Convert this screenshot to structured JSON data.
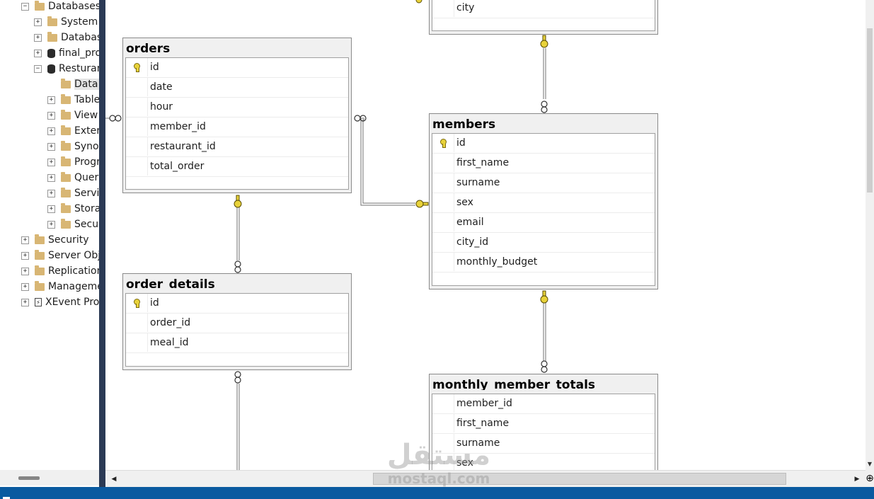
{
  "explorer": {
    "nodes": [
      {
        "label": "Databases",
        "level": 0,
        "expander": "minus",
        "icon": "folder-icon"
      },
      {
        "label": "System",
        "level": 1,
        "expander": "plus",
        "icon": "folder-icon"
      },
      {
        "label": "Databas",
        "level": 1,
        "expander": "plus",
        "icon": "folder-icon"
      },
      {
        "label": "final_pro",
        "level": 1,
        "expander": "plus",
        "icon": "database-icon"
      },
      {
        "label": "Resturan",
        "level": 1,
        "expander": "minus",
        "icon": "database-icon"
      },
      {
        "label": "Data",
        "level": 2,
        "expander": "none",
        "icon": "folder-icon",
        "selected": true
      },
      {
        "label": "Table",
        "level": 2,
        "expander": "plus",
        "icon": "folder-icon"
      },
      {
        "label": "View",
        "level": 2,
        "expander": "plus",
        "icon": "folder-icon"
      },
      {
        "label": "Exter",
        "level": 2,
        "expander": "plus",
        "icon": "folder-icon"
      },
      {
        "label": "Syno",
        "level": 2,
        "expander": "plus",
        "icon": "folder-icon"
      },
      {
        "label": "Progr",
        "level": 2,
        "expander": "plus",
        "icon": "folder-icon"
      },
      {
        "label": "Quer",
        "level": 2,
        "expander": "plus",
        "icon": "folder-icon"
      },
      {
        "label": "Servi",
        "level": 2,
        "expander": "plus",
        "icon": "folder-icon"
      },
      {
        "label": "Stora",
        "level": 2,
        "expander": "plus",
        "icon": "folder-icon"
      },
      {
        "label": "Secur",
        "level": 2,
        "expander": "plus",
        "icon": "folder-icon"
      },
      {
        "label": "Security",
        "level": 0,
        "expander": "plus",
        "icon": "folder-icon"
      },
      {
        "label": "Server Obje",
        "level": 0,
        "expander": "plus",
        "icon": "folder-icon"
      },
      {
        "label": "Replication",
        "level": 0,
        "expander": "plus",
        "icon": "folder-icon"
      },
      {
        "label": "Manageme",
        "level": 0,
        "expander": "plus",
        "icon": "folder-icon"
      },
      {
        "label": "XEvent Pro",
        "level": 0,
        "expander": "plus",
        "icon": "xevent-icon"
      }
    ]
  },
  "diagram": {
    "tables": [
      {
        "name": "",
        "columns": [
          {
            "name": "city",
            "pk": false
          }
        ]
      },
      {
        "name": "orders",
        "columns": [
          {
            "name": "id",
            "pk": true
          },
          {
            "name": "date",
            "pk": false
          },
          {
            "name": "hour",
            "pk": false
          },
          {
            "name": "member_id",
            "pk": false
          },
          {
            "name": "restaurant_id",
            "pk": false
          },
          {
            "name": "total_order",
            "pk": false
          }
        ]
      },
      {
        "name": "members",
        "columns": [
          {
            "name": "id",
            "pk": true
          },
          {
            "name": "first_name",
            "pk": false
          },
          {
            "name": "surname",
            "pk": false
          },
          {
            "name": "sex",
            "pk": false
          },
          {
            "name": "email",
            "pk": false
          },
          {
            "name": "city_id",
            "pk": false
          },
          {
            "name": "monthly_budget",
            "pk": false
          }
        ]
      },
      {
        "name": "order_details",
        "columns": [
          {
            "name": "id",
            "pk": true
          },
          {
            "name": "order_id",
            "pk": false
          },
          {
            "name": "meal_id",
            "pk": false
          }
        ]
      },
      {
        "name": "monthly_member_totals",
        "columns": [
          {
            "name": "member_id",
            "pk": false
          },
          {
            "name": "first_name",
            "pk": false
          },
          {
            "name": "surname",
            "pk": false
          },
          {
            "name": "sex",
            "pk": false
          }
        ]
      }
    ],
    "relationship_line_color": "#707070",
    "key_symbol_color": "#e8d23a"
  },
  "watermark": {
    "arabic": "مستقل",
    "latin": "mostaql.com"
  },
  "colors": {
    "splitter": "#2b3a55",
    "statusbar": "#0a5aa0"
  }
}
